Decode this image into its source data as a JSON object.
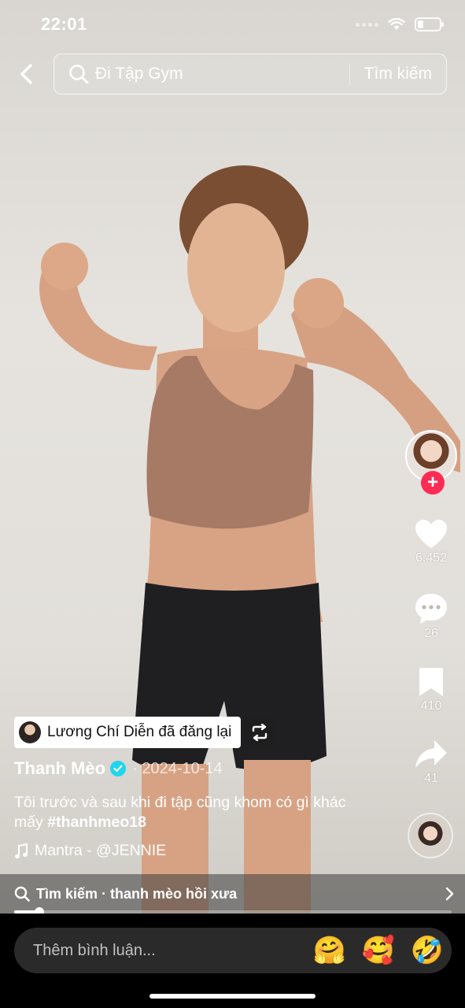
{
  "status_bar": {
    "time": "22:01",
    "battery_level": 0.25
  },
  "search": {
    "back_icon": "chevron-left-icon",
    "query": "Đi Tập Gym",
    "submit_label": "Tìm kiếm",
    "icon": "search-icon"
  },
  "creator": {
    "avatar_icon": "avatar",
    "follow_symbol": "+"
  },
  "actions": {
    "like": {
      "icon": "heart-icon",
      "count": "6.452"
    },
    "comment": {
      "icon": "comment-bubble-icon",
      "count": "26"
    },
    "save": {
      "icon": "bookmark-icon",
      "count": "410"
    },
    "share": {
      "icon": "share-arrow-icon",
      "count": "41"
    }
  },
  "repost": {
    "text": "Lương Chí Diễn đã đăng lại",
    "icon": "repost-icon"
  },
  "post": {
    "author": "Thanh Mèo",
    "separator": "·",
    "date": "2024-10-14",
    "caption": "Tôi trước và sau khi đi tập cũng khom có gì khác mấy",
    "hashtag": "#thanhmeo18",
    "music": "Mantra - @JENNIE"
  },
  "related_search": {
    "text": "Tìm kiếm · thanh mèo hồi xưa"
  },
  "playback": {
    "progress": 0.058
  },
  "comment_bar": {
    "placeholder": "Thêm bình luận...",
    "emojis": [
      "🤗",
      "🥰",
      "🤣"
    ]
  },
  "colors": {
    "follow": "#fe2c55",
    "verified": "#20d5ec"
  }
}
